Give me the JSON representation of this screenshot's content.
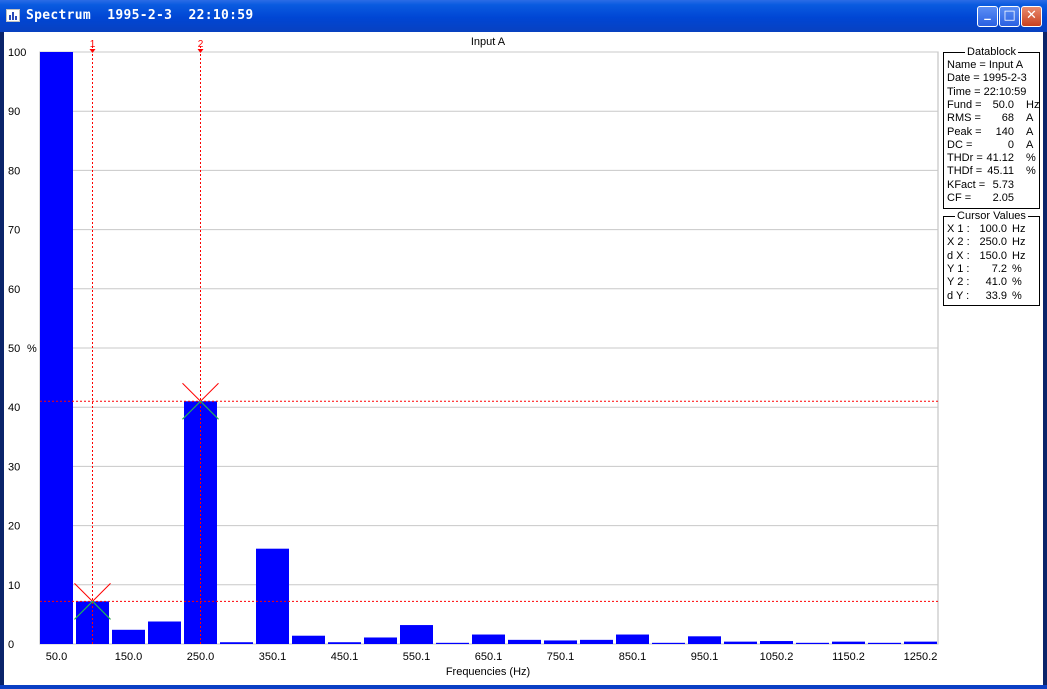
{
  "window": {
    "title": "Spectrum  1995-2-3  22:10:59"
  },
  "window_buttons": {
    "minimize": "_",
    "maximize": "□",
    "close": "✕"
  },
  "chart_data": {
    "type": "bar",
    "title": "Input A",
    "xlabel": "Frequencies (Hz)",
    "ylabel": "%",
    "ylim": [
      0,
      100
    ],
    "y_ticks": [
      "0",
      "10",
      "20",
      "30",
      "40",
      "50",
      "60",
      "70",
      "80",
      "90",
      "100"
    ],
    "x_tick_labels": [
      "50.0",
      "150.0",
      "250.0",
      "350.1",
      "450.1",
      "550.1",
      "650.1",
      "750.1",
      "850.1",
      "950.1",
      "1050.2",
      "1150.2",
      "1250.2"
    ],
    "bar_color": "#0000FF",
    "grid": "horizontal",
    "x": [
      50,
      100,
      150,
      200,
      250,
      300,
      350,
      400,
      450,
      500,
      550,
      600,
      650,
      700,
      750,
      800,
      850,
      900,
      950,
      1000,
      1050,
      1100,
      1150,
      1200,
      1250
    ],
    "values": [
      100,
      7.2,
      2.4,
      3.8,
      41.0,
      0.3,
      16.1,
      1.4,
      0.3,
      1.1,
      3.2,
      0.2,
      1.6,
      0.7,
      0.6,
      0.7,
      1.6,
      0.2,
      1.3,
      0.4,
      0.5,
      0.2,
      0.4,
      0.2,
      0.4
    ],
    "cursors": [
      {
        "label": "1",
        "x": 100,
        "y": 7.2
      },
      {
        "label": "2",
        "x": 250,
        "y": 41.0
      }
    ],
    "cursor_color": "#FF0000"
  },
  "datablock": {
    "title": "Datablock",
    "rows": [
      {
        "k": "Name = Input A",
        "v": "",
        "u": ""
      },
      {
        "k": "Date  = 1995-2-3",
        "v": "",
        "u": ""
      },
      {
        "k": "Time  = 22:10:59",
        "v": "",
        "u": ""
      },
      {
        "k": "Fund  =",
        "v": "50.0",
        "u": "Hz"
      },
      {
        "k": "RMS  =",
        "v": "68",
        "u": "A"
      },
      {
        "k": "Peak  =",
        "v": "140",
        "u": "A"
      },
      {
        "k": "DC     =",
        "v": "0",
        "u": "A"
      },
      {
        "k": "THDr  =",
        "v": "41.12",
        "u": "%"
      },
      {
        "k": "THDf  =",
        "v": "45.11",
        "u": "%"
      },
      {
        "k": "KFact  =",
        "v": "5.73",
        "u": ""
      },
      {
        "k": "CF     =",
        "v": "2.05",
        "u": ""
      }
    ]
  },
  "cursor_values": {
    "title": "Cursor Values",
    "rows": [
      {
        "k": "X 1 :",
        "v": "100.0",
        "u": "Hz"
      },
      {
        "k": "X 2 :",
        "v": "250.0",
        "u": "Hz"
      },
      {
        "k": "d X :",
        "v": "150.0",
        "u": "Hz"
      },
      {
        "k": "Y 1 :",
        "v": "7.2",
        "u": "%"
      },
      {
        "k": "Y 2 :",
        "v": "41.0",
        "u": "%"
      },
      {
        "k": "d Y :",
        "v": "33.9",
        "u": "%"
      }
    ]
  }
}
